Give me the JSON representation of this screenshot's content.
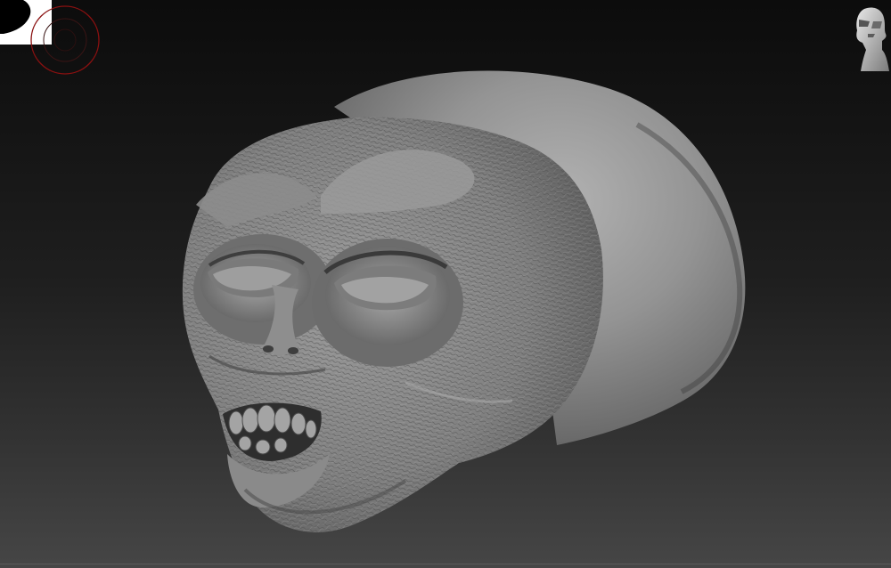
{
  "viewport": {
    "background_top": "#0c0c0c",
    "background_bottom": "#464646"
  },
  "overlays": {
    "top_left_badge_icon": "corner-badge-icon",
    "pivot_gizmo_icon": "rotation-gizmo-icon",
    "navigation_icon": "navigation-head-icon"
  },
  "model": {
    "icon": "alien-head-sculpt",
    "material_color": "#8a8a8a"
  }
}
